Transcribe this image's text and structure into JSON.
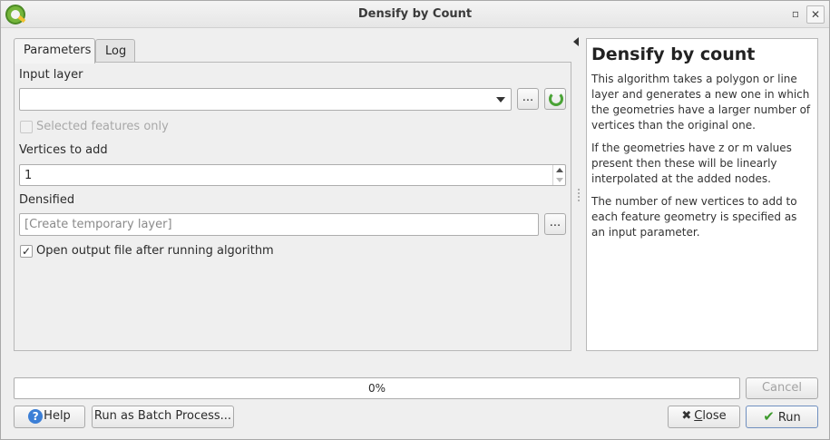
{
  "window": {
    "title": "Densify by Count"
  },
  "tabs": [
    {
      "label": "Parameters",
      "active": true
    },
    {
      "label": "Log",
      "active": false
    }
  ],
  "params": {
    "input_layer_label": "Input layer",
    "input_layer_value": "",
    "input_browse_label": "...",
    "selected_only_label": "Selected features only",
    "selected_only_checked": false,
    "vertices_label": "Vertices to add",
    "vertices_value": "1",
    "densified_label": "Densified",
    "densified_placeholder": "[Create temporary layer]",
    "densified_browse_label": "...",
    "open_output_label": "Open output file after running algorithm",
    "open_output_checked": true,
    "checkmark": "✓"
  },
  "help": {
    "title": "Densify by count",
    "paragraphs": [
      "This algorithm takes a polygon or line layer and generates a new one in which the geometries have a larger number of vertices than the original one.",
      "If the geometries have z or m values present then these will be linearly interpolated at the added nodes.",
      "The number of new vertices to add to each feature geometry is specified as an input parameter."
    ]
  },
  "progress": {
    "text": "0%",
    "value": 0
  },
  "buttons": {
    "cancel": "Cancel",
    "help": "Help",
    "batch": "Run as Batch Process...",
    "close_mnemonic": "C",
    "close_rest": "lose",
    "run": "Run"
  },
  "icons": {
    "app": "qgis-logo-icon",
    "help": "help-icon",
    "close": "close-x-icon",
    "run": "checkmark-icon",
    "refresh": "refresh-icon",
    "collapse": "collapse-left-icon"
  },
  "colors": {
    "help_icon": "#3c7fd6",
    "run_check": "#3f9b2e",
    "refresh": "#4aa336"
  }
}
